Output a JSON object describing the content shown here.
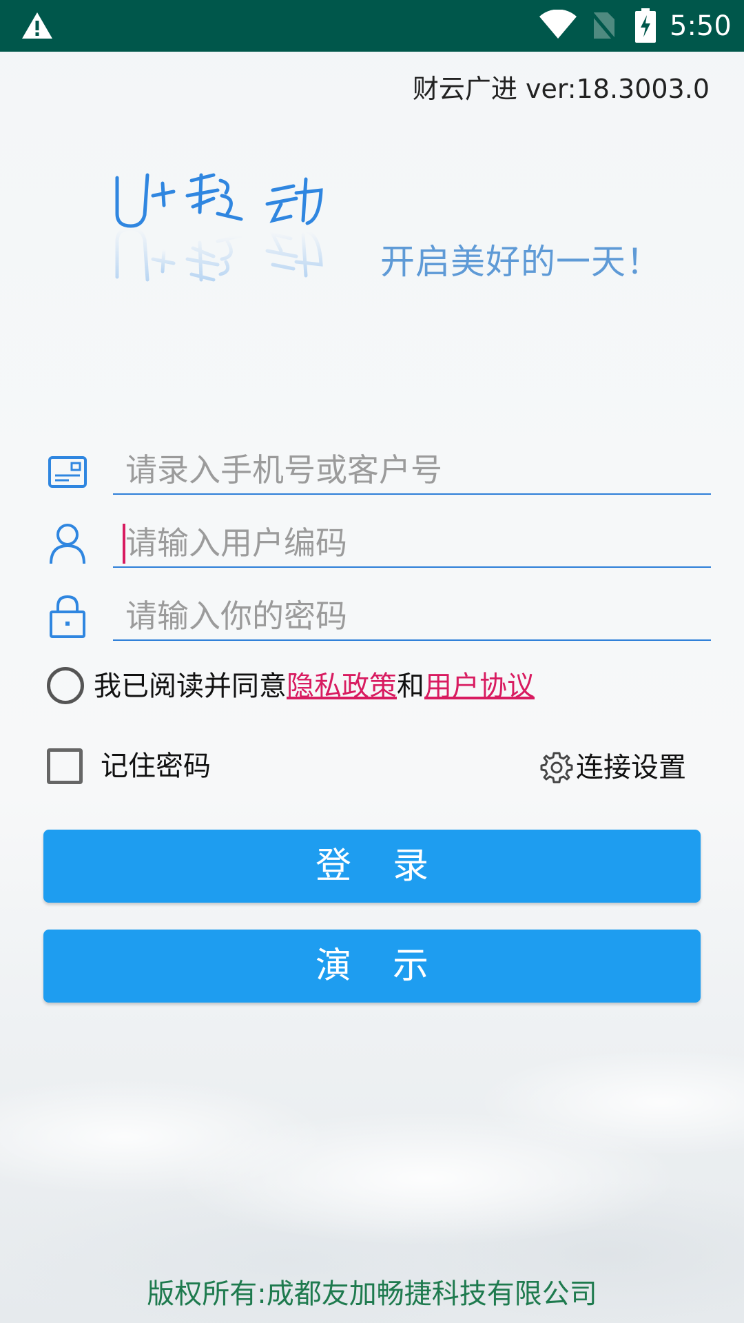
{
  "status_bar": {
    "time": "5:50",
    "icons": [
      "warning-icon",
      "wifi-icon",
      "no-sim-icon",
      "battery-charging-icon"
    ]
  },
  "header": {
    "version": "财云广进 ver:18.3003.0"
  },
  "branding": {
    "logo_text": "U+移动",
    "slogan": "开启美好的一天！"
  },
  "form": {
    "account_placeholder": "请录入手机号或客户号",
    "account_value": "",
    "user_code_placeholder": "请输入用户编码",
    "user_code_value": "",
    "password_placeholder": "请输入你的密码",
    "password_value": ""
  },
  "agreement": {
    "prefix": "我已阅读并同意",
    "privacy_link": "隐私政策",
    "and": "和",
    "user_agreement_link": "用户协议",
    "checked": false
  },
  "options": {
    "remember_password_label": "记住密码",
    "remember_checked": false,
    "connection_settings_label": "连接设置"
  },
  "buttons": {
    "login": "登录",
    "demo": "演示"
  },
  "footer": {
    "copyright": "版权所有:成都友加畅捷科技有限公司"
  },
  "colors": {
    "status_bar": "#00574b",
    "primary_button": "#1e9df0",
    "link": "#d81b60",
    "input_underline": "#2c7ed8",
    "copyright": "#1e7a4e"
  }
}
